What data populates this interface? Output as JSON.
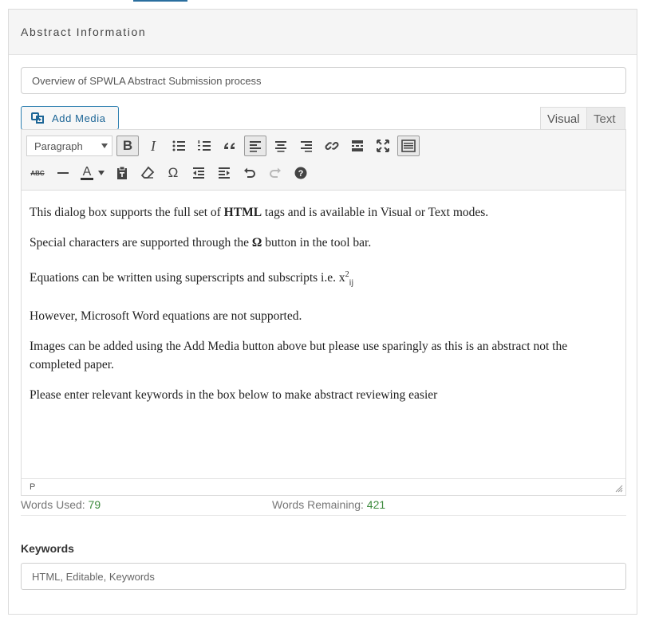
{
  "panel": {
    "title": "Abstract Information"
  },
  "title_field": {
    "value": "Overview of SPWLA Abstract Submission process"
  },
  "media": {
    "add_label": "Add Media"
  },
  "mode_tabs": {
    "visual": "Visual",
    "text": "Text"
  },
  "toolbar": {
    "format_value": "Paragraph",
    "row1_icons": [
      "bold-icon",
      "italic-icon",
      "bullet-list-icon",
      "numbered-list-icon",
      "blockquote-icon",
      "align-left-icon",
      "align-center-icon",
      "align-right-icon",
      "link-icon",
      "read-more-icon",
      "fullscreen-icon",
      "toolbar-toggle-icon"
    ],
    "row2_icons": [
      "strikethrough-icon",
      "horizontal-line-icon",
      "text-color-icon",
      "paste-as-text-icon",
      "clear-formatting-icon",
      "special-character-icon",
      "outdent-icon",
      "indent-icon",
      "undo-icon",
      "redo-icon",
      "help-icon"
    ],
    "bold_glyph": "B",
    "italic_glyph": "I",
    "omega_glyph": "Ω",
    "text_color_glyph": "A",
    "strike_glyph": "ABC"
  },
  "editor": {
    "p1_a": "This dialog box supports the full set of ",
    "p1_b": "HTML",
    "p1_c": " tags and is available in Visual or Text modes.",
    "p2_a": "Special characters are supported through the ",
    "p2_b": "Ω",
    "p2_c": " button in the tool bar.",
    "p3_a": "Equations can be written using superscripts and subscripts i.e. x",
    "p3_sup": "2",
    "p3_sub": "ij",
    "p4": "However, Microsoft Word equations are not supported.",
    "p5": "Images can be added using the Add Media button above but please use sparingly as this is an abstract not the completed paper.",
    "p6": "Please enter relevant keywords in the box below to make abstract reviewing easier",
    "path": "P"
  },
  "word_count": {
    "used_label": "Words Used: ",
    "used_value": "79",
    "remaining_label": "Words Remaining: ",
    "remaining_value": "421"
  },
  "keywords": {
    "label": "Keywords",
    "value": "HTML, Editable, Keywords"
  },
  "colors": {
    "accent": "#2e7fb0",
    "count_green": "#3c8a3c"
  }
}
